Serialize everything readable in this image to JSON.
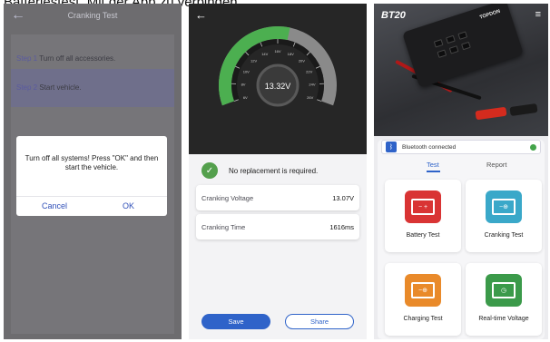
{
  "caption": "Batteriestest. Mit der App zu verbinden.",
  "phone1": {
    "back_icon": "←",
    "title": "Cranking Test",
    "steps": [
      {
        "num": "Step 1",
        "text": " Turn off all accessories."
      },
      {
        "num": "Step 2",
        "text": " Start vehicle."
      }
    ],
    "dialog": {
      "message": "Turn off all systems! Press \"OK\" and then start the vehicle.",
      "cancel": "Cancel",
      "ok": "OK"
    }
  },
  "phone2": {
    "back_icon": "←",
    "gauge": {
      "reading": "13.32V",
      "tick_labels": [
        "6V",
        "8V",
        "10V",
        "12V",
        "14V",
        "16V",
        "18V",
        "20V",
        "22V",
        "24V",
        "26V"
      ],
      "green_color": "#4caf50",
      "grey_color": "#8a8a8a"
    },
    "status_text": "No replacement is required.",
    "rows": [
      {
        "label": "Cranking Voltage",
        "value": "13.07V"
      },
      {
        "label": "Cranking Time",
        "value": "1616ms"
      }
    ],
    "save": "Save",
    "share": "Share"
  },
  "phone3": {
    "brand": "BT20",
    "menu_icon": "≡",
    "device_logo": "TOPDON",
    "bluetooth_text": "Bluetooth connected",
    "tabs": {
      "test": "Test",
      "report": "Report"
    },
    "tiles": [
      {
        "label": "Battery Test",
        "color": "#d93434"
      },
      {
        "label": "Cranking Test",
        "color": "#3aa8c9"
      },
      {
        "label": "Charging Test",
        "color": "#e98a2a"
      },
      {
        "label": "Real-time Voltage",
        "color": "#3b9a4a"
      }
    ]
  }
}
